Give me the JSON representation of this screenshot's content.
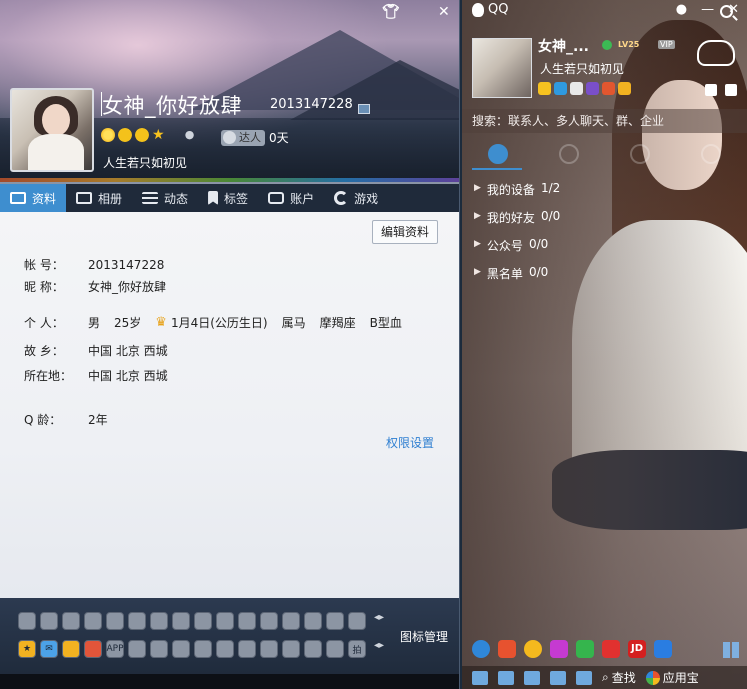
{
  "profile": {
    "nickname": "女神_你好放肆",
    "qq_number": "2013147228",
    "daren_label": "达人",
    "daren_days": "0天",
    "signature": "人生若只如初见",
    "edit_button": "编辑资料",
    "permission_link": "权限设置",
    "tabs": [
      {
        "label": "资料",
        "icon": "profile-card-icon",
        "active": true
      },
      {
        "label": "相册",
        "icon": "photo-album-icon",
        "active": false
      },
      {
        "label": "动态",
        "icon": "feed-list-icon",
        "active": false
      },
      {
        "label": "标签",
        "icon": "bookmark-tag-icon",
        "active": false
      },
      {
        "label": "账户",
        "icon": "wallet-bag-icon",
        "active": false
      },
      {
        "label": "游戏",
        "icon": "game-icon",
        "active": false
      }
    ],
    "fields": {
      "account_label": "帐    号：",
      "account_value": "2013147228",
      "nick_label": "昵    称：",
      "nick_value": "女神_你好放肆",
      "personal_label": "个    人：",
      "gender": "男",
      "age": "25岁",
      "birthday": "1月4日(公历生日)",
      "zodiac": "属马",
      "constellation": "摩羯座",
      "blood": "B型血",
      "hometown_label": "故    乡：",
      "hometown_value": "中国 北京 西城",
      "location_label": "所在地：",
      "location_value": "中国 北京 西城",
      "qage_label": "Q    龄：",
      "qage_value": "2年"
    },
    "icon_wall_manage": "图标管理",
    "icon_wall_labels": [
      "APP",
      "拍"
    ]
  },
  "qq_panel": {
    "title": "QQ",
    "nickname": "女神_...",
    "level_badge": "LV25",
    "vip_badge": "VIP",
    "signature": "人生若只如初见",
    "search_placeholder": "搜索：联系人、多人聊天、群、企业",
    "groups": [
      {
        "name": "我的设备",
        "count": "1/2"
      },
      {
        "name": "我的好友",
        "count": "0/0"
      },
      {
        "name": "公众号",
        "count": "0/0"
      },
      {
        "name": "黑名单",
        "count": "0/0"
      }
    ],
    "app_jd_label": "JD",
    "bottom_find": "查找",
    "bottom_appstore": "应用宝"
  },
  "colors": {
    "accent_blue": "#3e8ecf",
    "link_blue": "#2f7fd1",
    "online_green": "#3cba54"
  }
}
